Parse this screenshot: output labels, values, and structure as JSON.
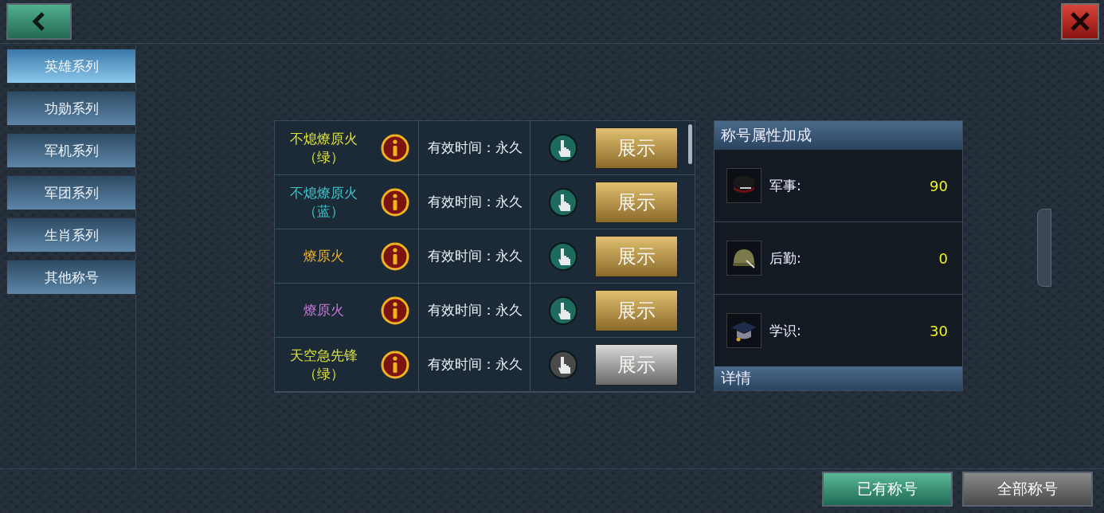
{
  "categories": [
    {
      "label": "英雄系列",
      "selected": true
    },
    {
      "label": "功勋系列",
      "selected": false
    },
    {
      "label": "军机系列",
      "selected": false
    },
    {
      "label": "军团系列",
      "selected": false
    },
    {
      "label": "生肖系列",
      "selected": false
    },
    {
      "label": "其他称号",
      "selected": false
    }
  ],
  "titles": [
    {
      "name": "不熄燎原火",
      "suffix": "（绿）",
      "color": "#dce23a",
      "validity": "有效时间：永久",
      "action": "展示",
      "enabled": true
    },
    {
      "name": "不熄燎原火",
      "suffix": "（蓝）",
      "color": "#3ec6c8",
      "validity": "有效时间：永久",
      "action": "展示",
      "enabled": true
    },
    {
      "name": "燎原火",
      "color": "#f0b428",
      "validity": "有效时间：永久",
      "action": "展示",
      "enabled": true
    },
    {
      "name": "燎原火",
      "color": "#c878d8",
      "validity": "有效时间：永久",
      "action": "展示",
      "enabled": true
    },
    {
      "name": "天空急先锋",
      "suffix": "（绿）",
      "color": "#dce23a",
      "validity": "有效时间：永久",
      "action": "展示",
      "enabled": false
    }
  ],
  "bonus_panel": {
    "title": "称号属性加成",
    "stats": [
      {
        "kind": "cap",
        "label": "军事:",
        "value": "90"
      },
      {
        "kind": "helmet",
        "label": "后勤:",
        "value": "0"
      },
      {
        "kind": "mortarboard",
        "label": "学识:",
        "value": "30"
      }
    ],
    "details_title": "详情"
  },
  "bottom_tabs": [
    {
      "label": "已有称号",
      "selected": true
    },
    {
      "label": "全部称号",
      "selected": false
    }
  ]
}
